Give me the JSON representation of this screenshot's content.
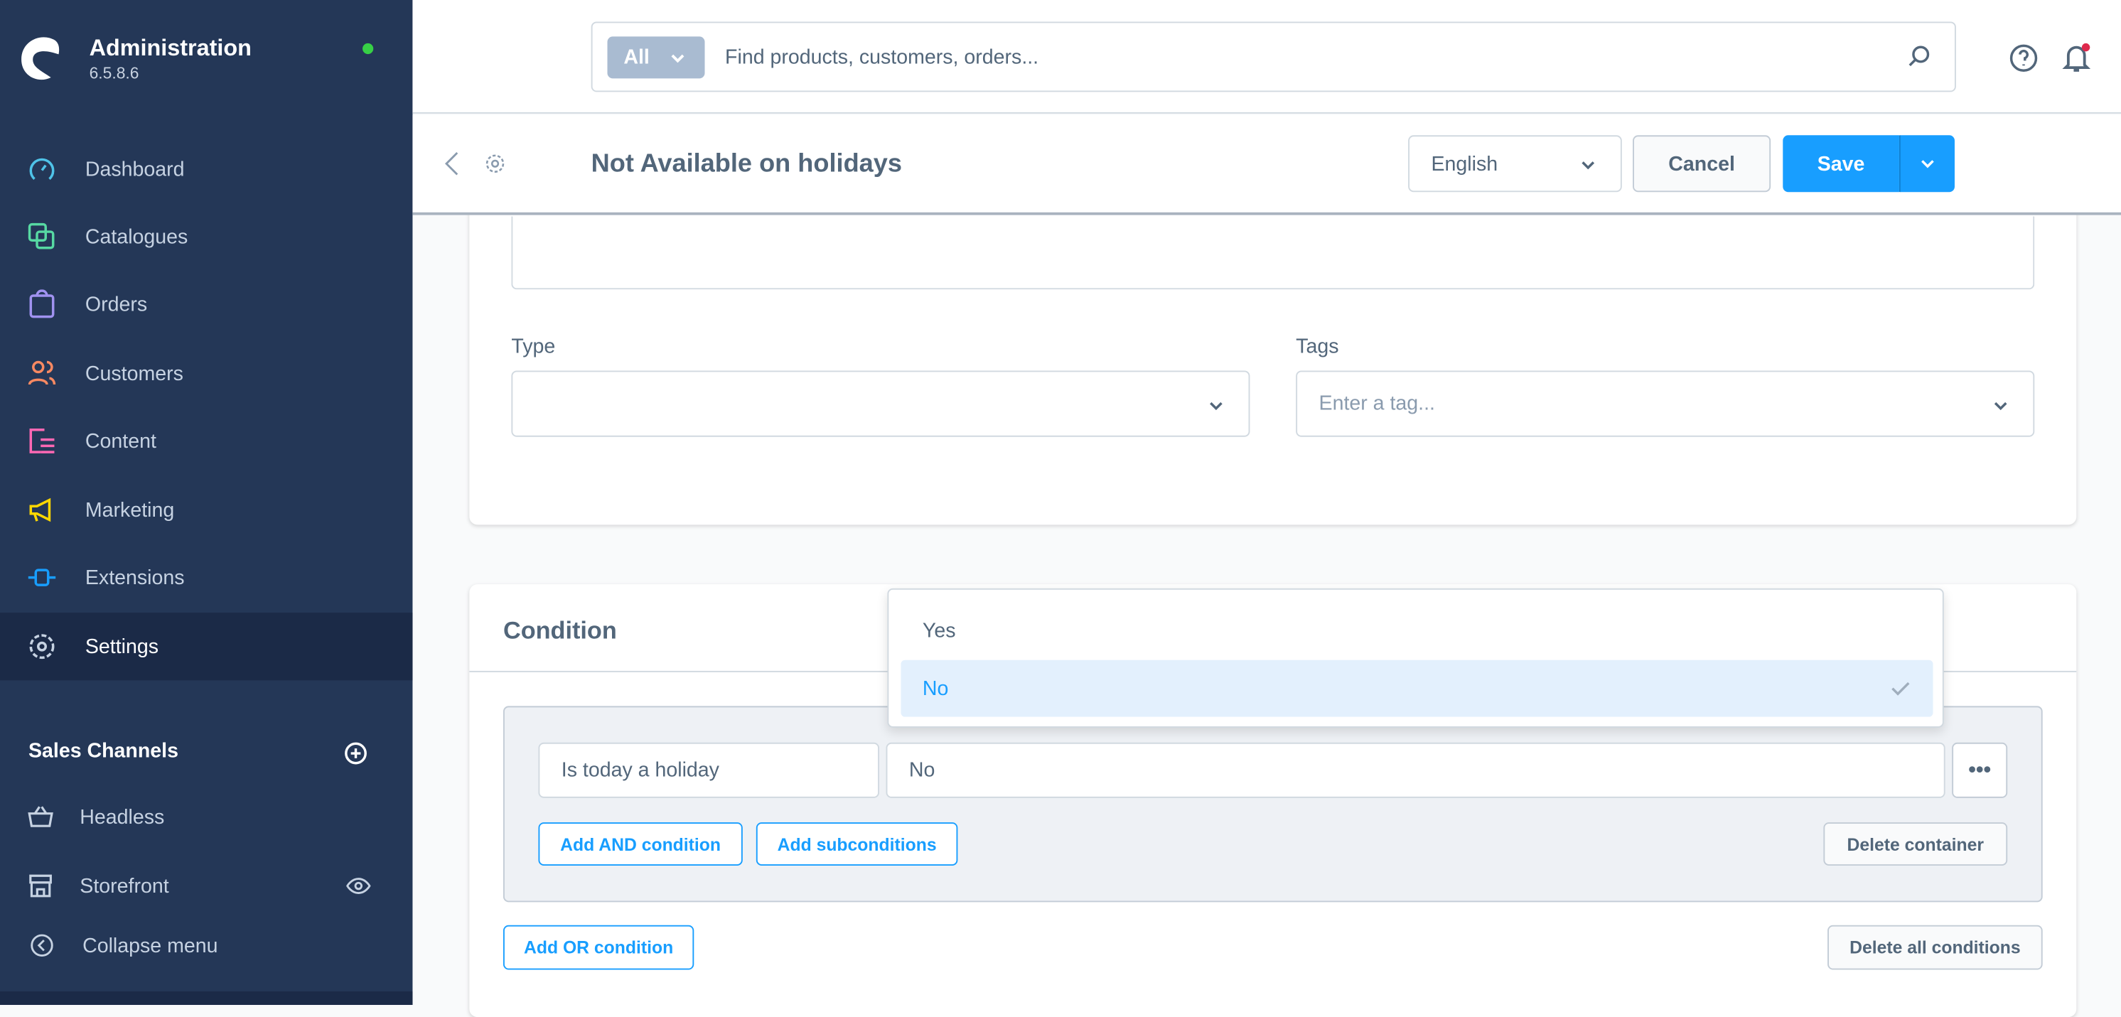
{
  "app": {
    "title": "Administration",
    "version": "6.5.8.6",
    "status_color": "#37d046"
  },
  "sidebar": {
    "items": [
      {
        "label": "Dashboard",
        "icon": "dashboard-icon",
        "color": "#4fc3e8"
      },
      {
        "label": "Catalogues",
        "icon": "catalogues-icon",
        "color": "#57d9a3"
      },
      {
        "label": "Orders",
        "icon": "orders-icon",
        "color": "#a092f0"
      },
      {
        "label": "Customers",
        "icon": "customers-icon",
        "color": "#f88962"
      },
      {
        "label": "Content",
        "icon": "content-icon",
        "color": "#ff68b4"
      },
      {
        "label": "Marketing",
        "icon": "marketing-icon",
        "color": "#ffd700"
      },
      {
        "label": "Extensions",
        "icon": "extensions-icon",
        "color": "#189eff"
      },
      {
        "label": "Settings",
        "icon": "settings-icon",
        "color": "#c6d2e2",
        "active": true
      }
    ],
    "sales_channels_title": "Sales Channels",
    "channels": [
      {
        "label": "Headless"
      },
      {
        "label": "Storefront"
      }
    ],
    "collapse_label": "Collapse menu"
  },
  "search": {
    "type": "All",
    "placeholder": "Find products, customers, orders..."
  },
  "smartbar": {
    "title": "Not Available on holidays",
    "language": "English",
    "cancel": "Cancel",
    "save": "Save"
  },
  "form": {
    "type_label": "Type",
    "type_value": "",
    "tags_label": "Tags",
    "tags_placeholder": "Enter a tag..."
  },
  "condition": {
    "title": "Condition",
    "field": "Is today a holiday",
    "value": "No",
    "add_and": "Add AND condition",
    "add_sub": "Add subconditions",
    "delete_container": "Delete container",
    "add_or": "Add OR condition",
    "delete_all": "Delete all conditions",
    "options": [
      {
        "label": "Yes"
      },
      {
        "label": "No",
        "selected": true
      }
    ]
  },
  "colors": {
    "accent": "#189eff",
    "sidebar": "#243757"
  }
}
